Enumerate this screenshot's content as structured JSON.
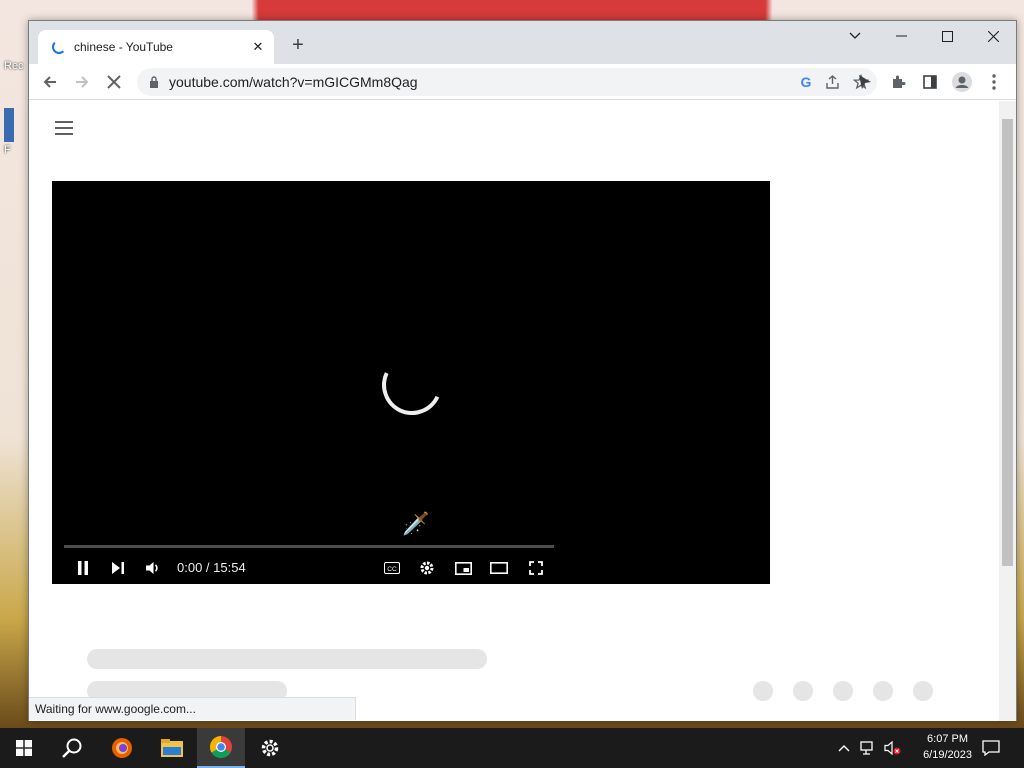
{
  "desktop": {
    "icon_label_1": "Rec",
    "icon_label_2": "F"
  },
  "browser": {
    "tab": {
      "title": "chinese - YouTube",
      "close": "✕"
    },
    "new_tab": "+",
    "window_controls": {
      "dropdown": "⌄",
      "minimize": "—",
      "maximize": "☐",
      "close": "✕"
    },
    "url": "youtube.com/watch?v=mGICGMm8Qag",
    "status": "Waiting for www.google.com..."
  },
  "player": {
    "current_time": "0:00",
    "duration": "15:54",
    "time_label": "0:00 / 15:54",
    "progress": 0
  },
  "taskbar": {
    "clock_time": "6:07 PM",
    "clock_date": "6/19/2023"
  },
  "colors": {
    "tab_strip": "#dee1e6",
    "loading_blue": "#1a73e8",
    "taskbar": "#1b1b1b"
  }
}
